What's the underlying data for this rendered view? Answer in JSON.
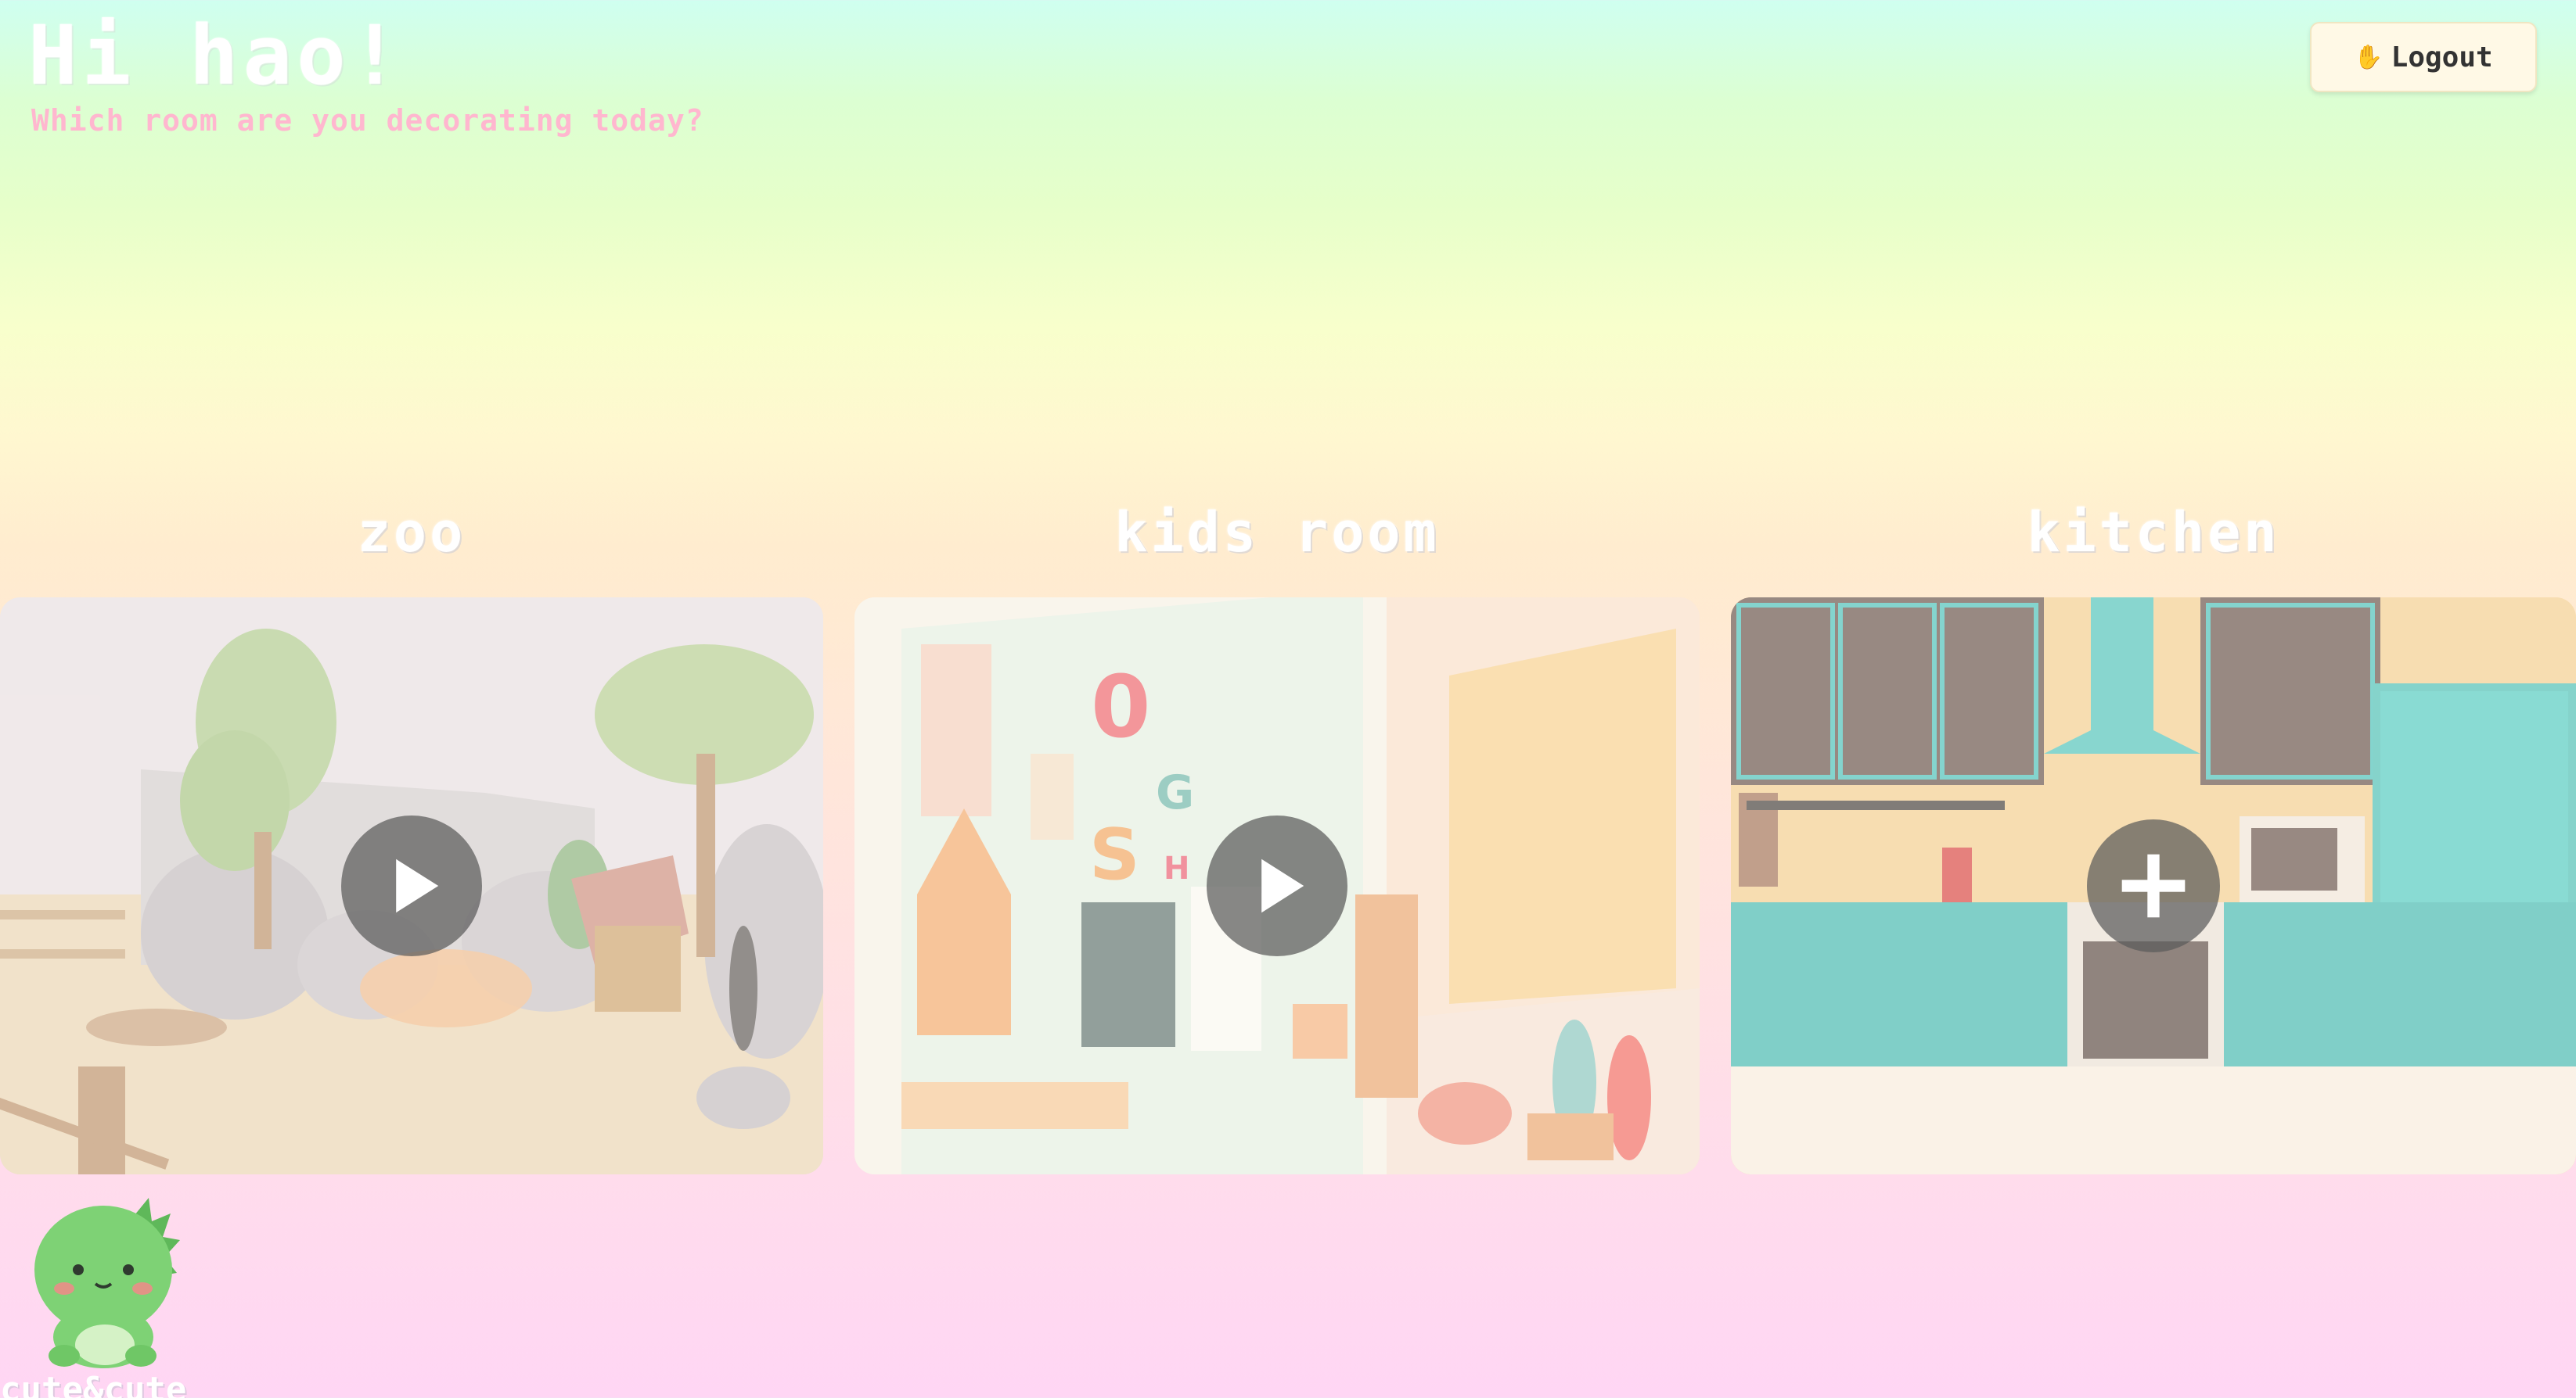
{
  "header": {
    "greeting": "Hi hao!",
    "subtitle": "Which room are you decorating today?",
    "logout_label": "Logout",
    "logout_icon": "waving-hand-icon"
  },
  "rooms": [
    {
      "title": "zoo",
      "action": "play",
      "action_icon": "play-icon"
    },
    {
      "title": "kids room",
      "action": "play",
      "action_icon": "play-icon"
    },
    {
      "title": "kitchen",
      "action": "add",
      "action_icon": "plus-icon"
    }
  ],
  "footer": {
    "brand": "cute&cute",
    "mascot_icon": "green-dinosaur-mascot"
  },
  "colors": {
    "subtitle": "#ffb7cf",
    "logout_bg": "#fff9e6",
    "overlay_button": "#5a5a5a"
  }
}
